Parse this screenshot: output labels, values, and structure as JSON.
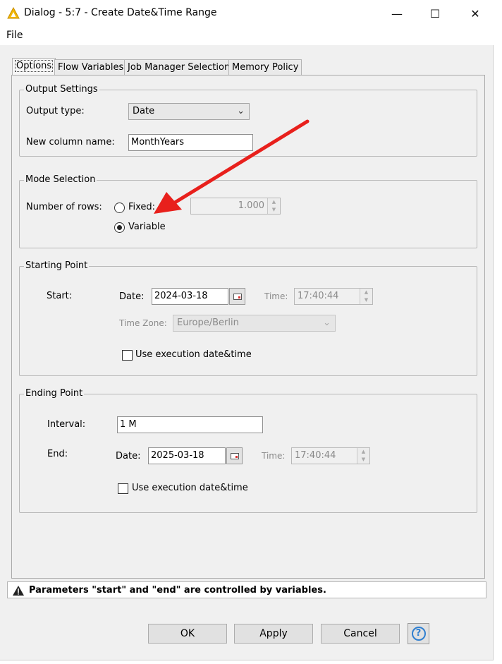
{
  "window": {
    "title": "Dialog - 5:7 - Create Date&Time Range",
    "minimize": "—",
    "maximize": "☐",
    "close": "✕"
  },
  "menu": {
    "file": "File"
  },
  "tabs": [
    {
      "label": "Options",
      "active": true
    },
    {
      "label": "Flow Variables"
    },
    {
      "label": "Job Manager Selection"
    },
    {
      "label": "Memory Policy"
    }
  ],
  "output_settings": {
    "legend": "Output Settings",
    "output_type_label": "Output type:",
    "output_type_value": "Date",
    "column_name_label": "New column name:",
    "column_name_value": "MonthYears"
  },
  "mode_selection": {
    "legend": "Mode Selection",
    "rows_label": "Number of rows:",
    "fixed_label": "Fixed:",
    "fixed_value": "1.000",
    "variable_label": "Variable",
    "selected": "Variable"
  },
  "starting_point": {
    "legend": "Starting Point",
    "start_label": "Start:",
    "date_label": "Date:",
    "date_value": "2024-03-18",
    "time_label": "Time:",
    "time_value": "17:40:44",
    "timezone_label": "Time Zone:",
    "timezone_value": "Europe/Berlin",
    "use_exec_label": "Use execution date&time"
  },
  "ending_point": {
    "legend": "Ending Point",
    "interval_label": "Interval:",
    "interval_value": "1 M",
    "end_label": "End:",
    "date_label": "Date:",
    "date_value": "2025-03-18",
    "time_label": "Time:",
    "time_value": "17:40:44",
    "use_exec_label": "Use execution date&time"
  },
  "status": {
    "message": "Parameters \"start\" and \"end\" are controlled by variables."
  },
  "buttons": {
    "ok": "OK",
    "apply": "Apply",
    "cancel": "Cancel",
    "help": "?"
  },
  "colors": {
    "arrow": "#e8201c",
    "warning_icon": "#222222",
    "title_icon": "#f2b705"
  }
}
